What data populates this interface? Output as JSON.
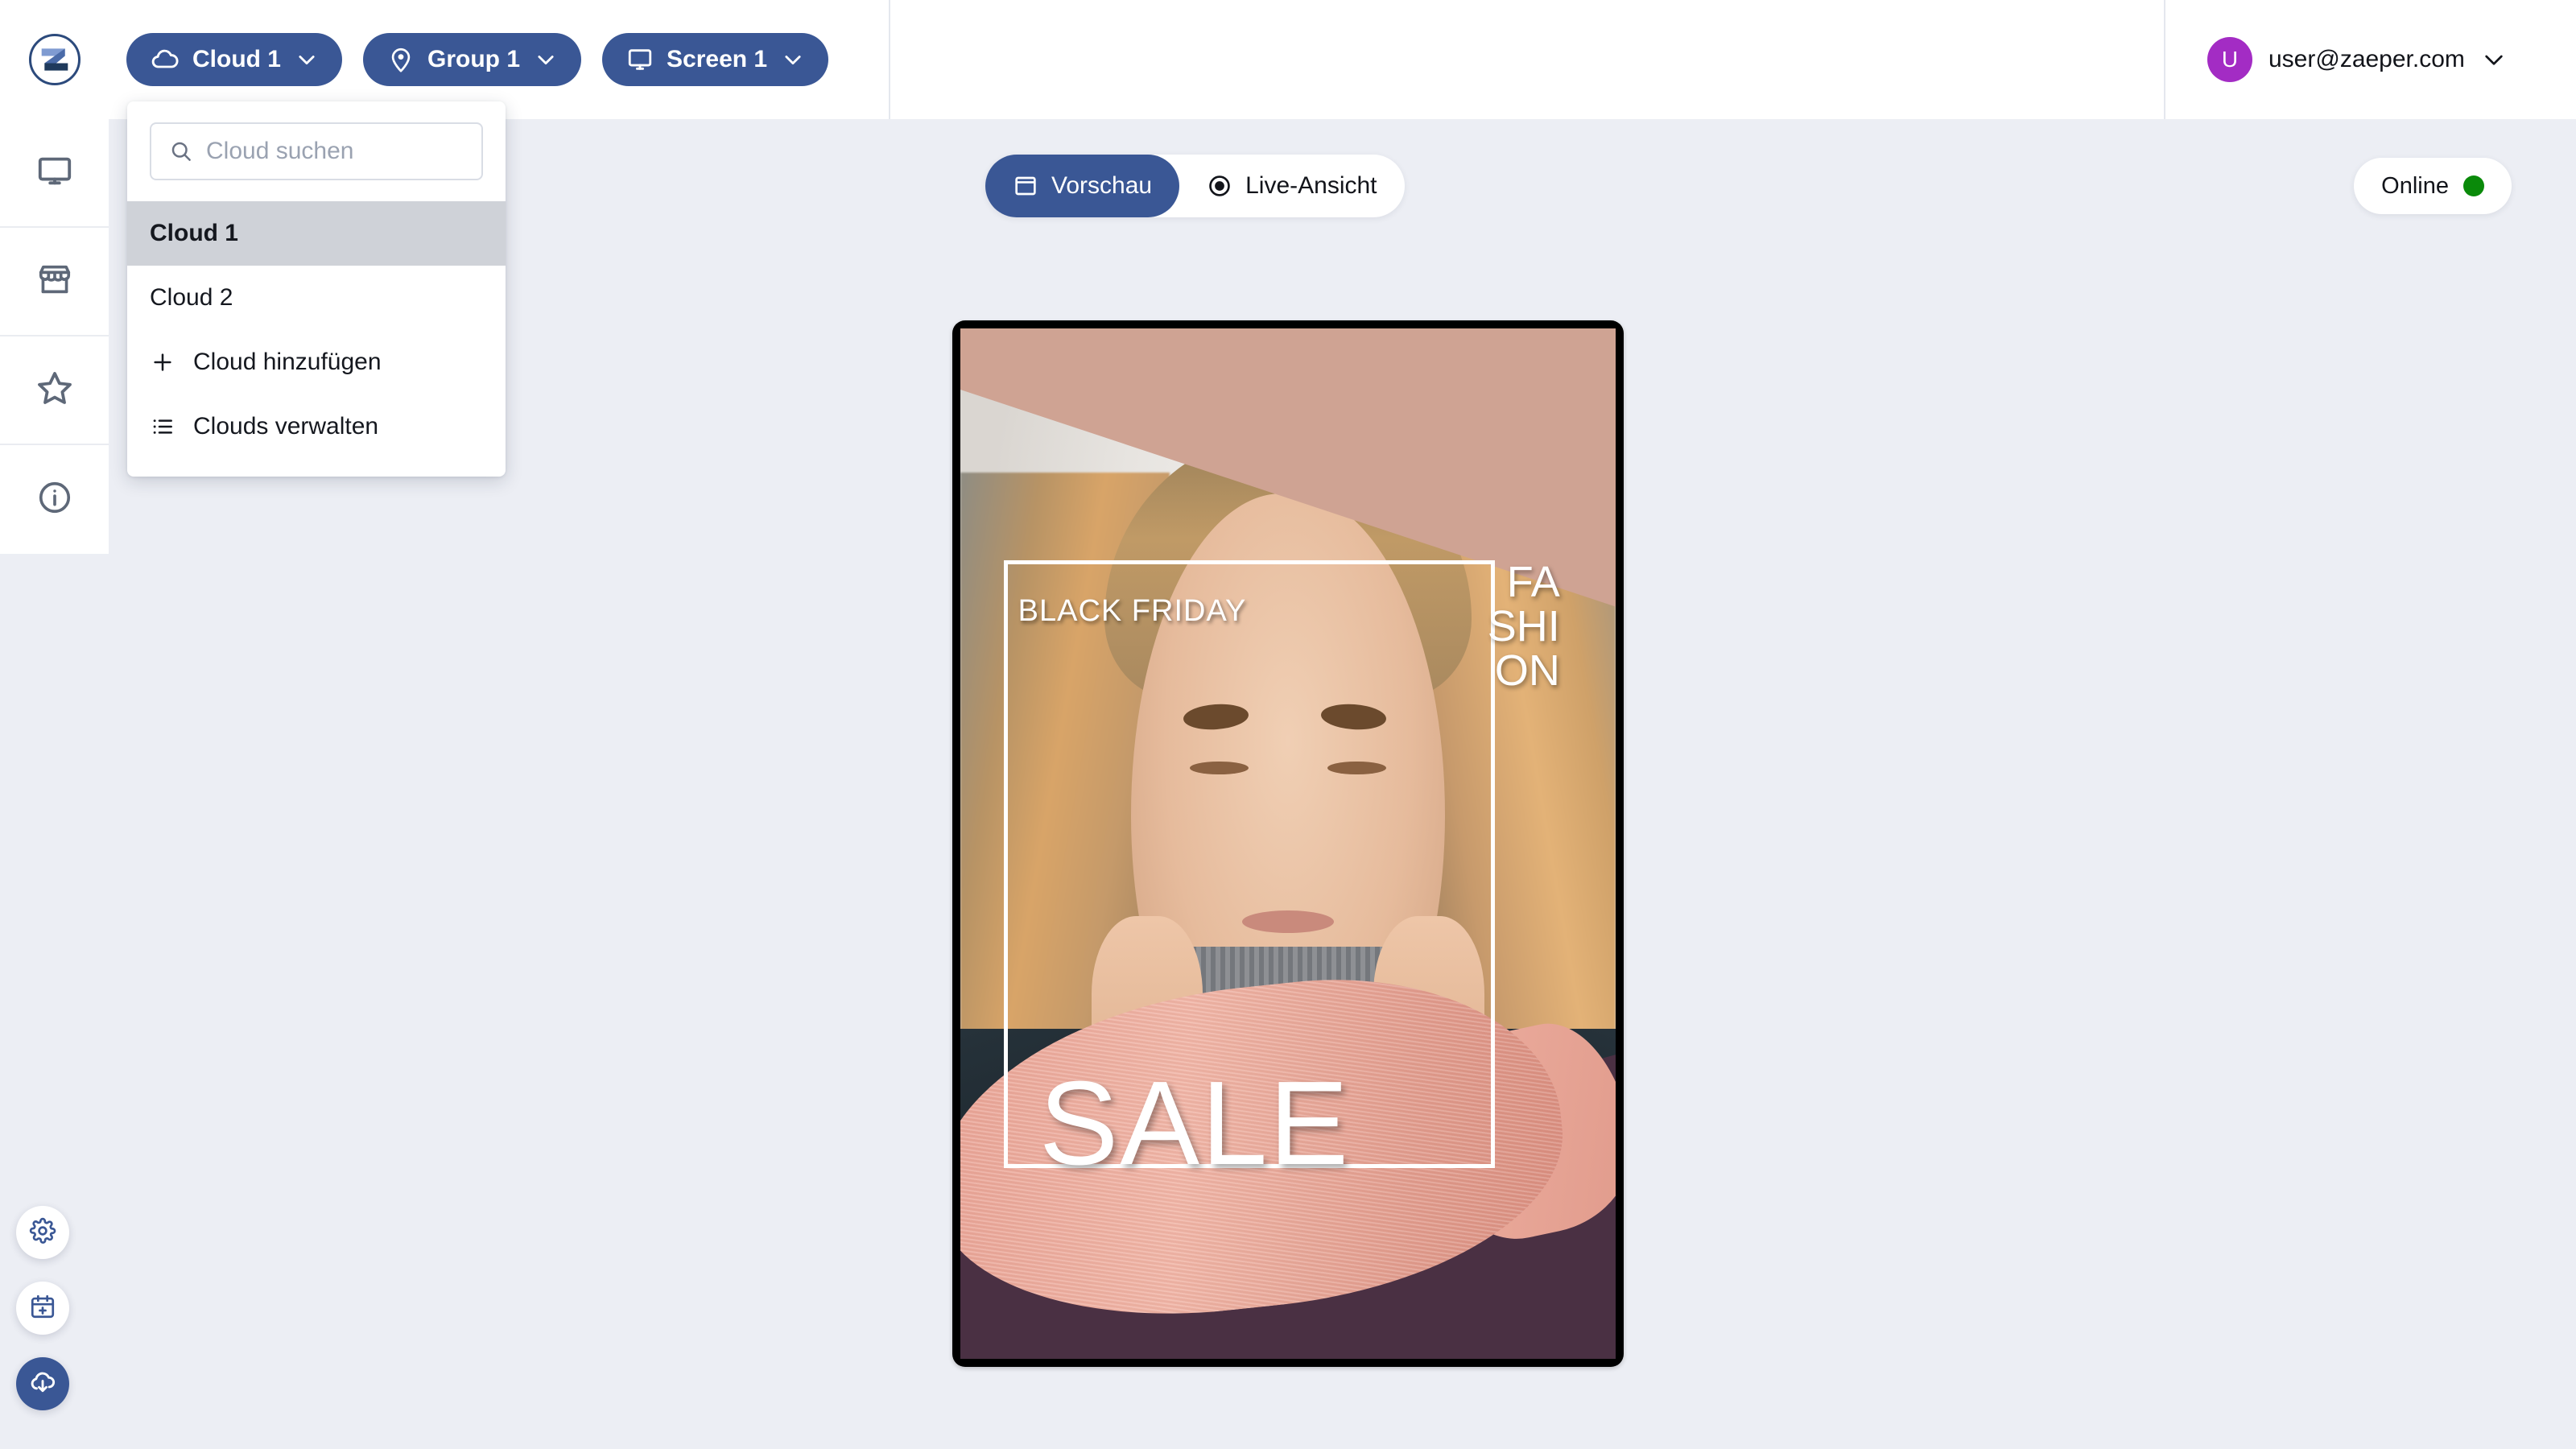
{
  "app": {
    "logo_alt": "Zaeper logo"
  },
  "header": {
    "chips": [
      {
        "id": "cloud",
        "label": "Cloud 1",
        "icon": "cloud-icon"
      },
      {
        "id": "group",
        "label": "Group 1",
        "icon": "location-pin-icon"
      },
      {
        "id": "screen",
        "label": "Screen 1",
        "icon": "monitor-icon"
      }
    ],
    "user": {
      "avatar_initial": "U",
      "email": "user@zaeper.com",
      "avatar_color": "#a32cc4"
    }
  },
  "sidebar": {
    "items": [
      {
        "id": "screens",
        "icon": "monitor-icon"
      },
      {
        "id": "store",
        "icon": "store-icon"
      },
      {
        "id": "favorites",
        "icon": "star-icon"
      },
      {
        "id": "info",
        "icon": "info-circle-icon"
      }
    ],
    "fabs": [
      {
        "id": "settings",
        "icon": "gear-icon",
        "variant": "light"
      },
      {
        "id": "schedule",
        "icon": "calendar-plus-icon",
        "variant": "light"
      },
      {
        "id": "publish",
        "icon": "cloud-download-icon",
        "variant": "primary"
      }
    ]
  },
  "cloud_dropdown": {
    "search": {
      "placeholder": "Cloud suchen",
      "value": "",
      "icon": "search-icon"
    },
    "clouds": [
      {
        "label": "Cloud 1",
        "selected": true
      },
      {
        "label": "Cloud 2",
        "selected": false
      }
    ],
    "actions": [
      {
        "label": "Cloud hinzufügen",
        "icon": "plus-icon"
      },
      {
        "label": "Clouds verwalten",
        "icon": "list-icon"
      }
    ]
  },
  "view_toggle": {
    "options": [
      {
        "label": "Vorschau",
        "icon": "window-icon",
        "active": true
      },
      {
        "label": "Live-Ansicht",
        "icon": "record-dot-icon",
        "active": false
      }
    ]
  },
  "status": {
    "label": "Online",
    "color": "#0a8a0a"
  },
  "preview": {
    "black_friday": "BLACK FRIDAY",
    "fashion_line1": "FA",
    "fashion_line2": "SHI",
    "fashion_line3": "ON",
    "sale": "SALE",
    "colors": {
      "band": "#cfa393",
      "wedge": "#4a3043",
      "brush": "#e8a193"
    }
  },
  "theme": {
    "accent": "#3a5795",
    "canvas": "#eceef4",
    "panel": "#ffffff"
  }
}
